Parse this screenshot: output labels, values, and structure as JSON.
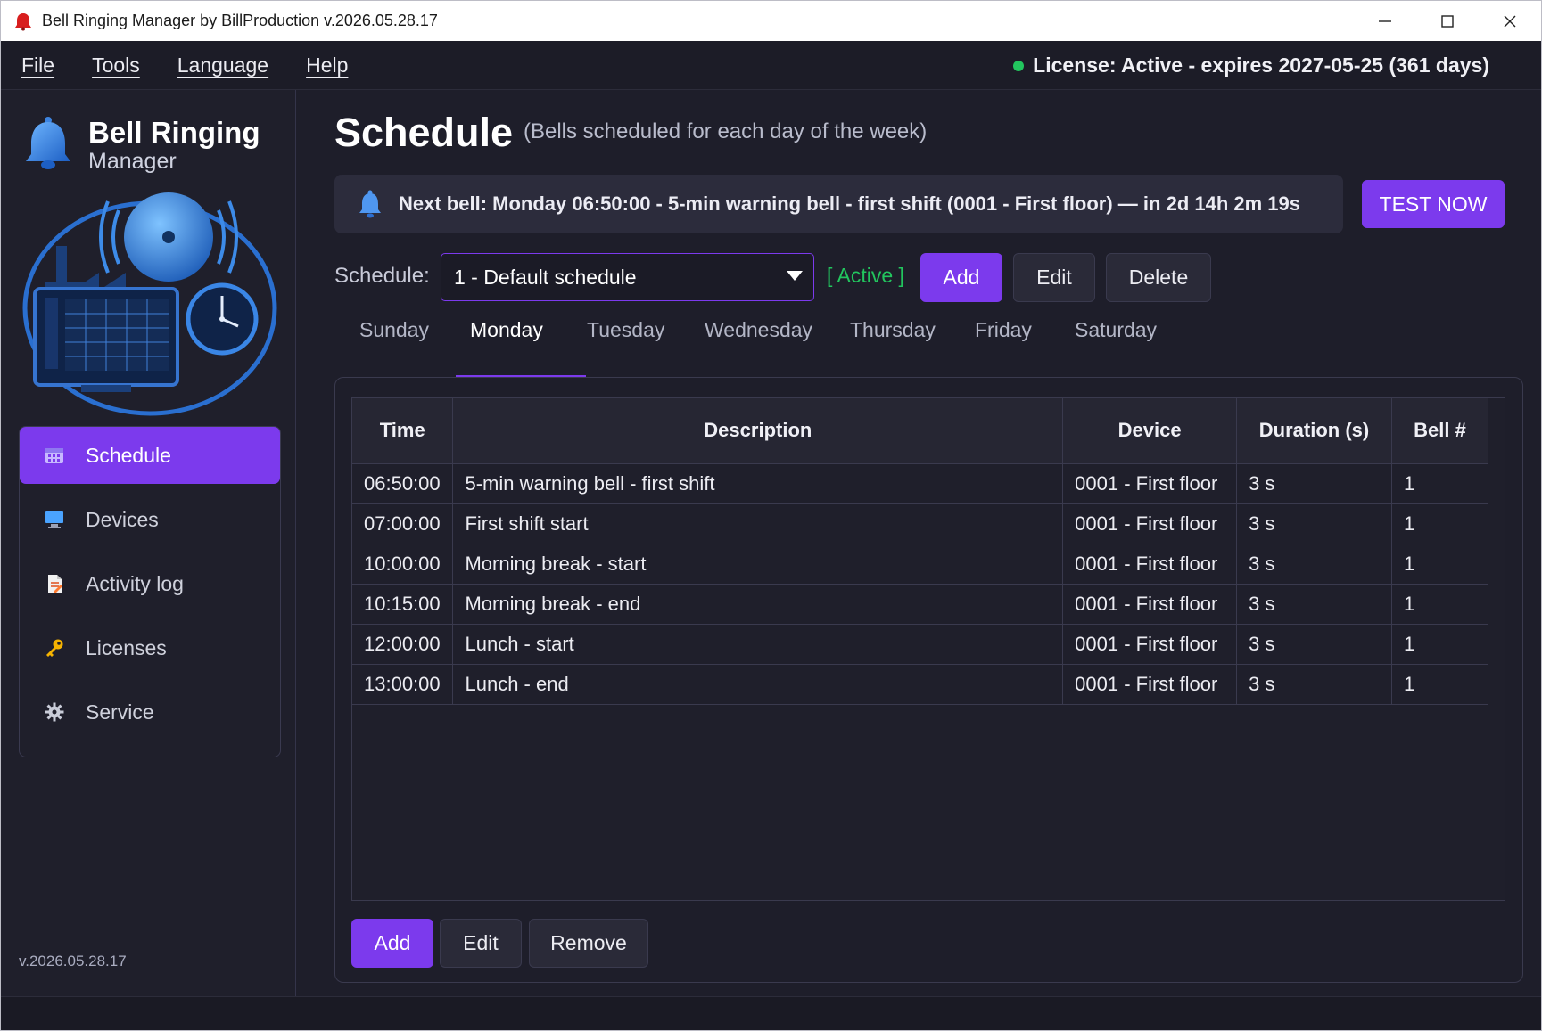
{
  "window": {
    "title": "Bell Ringing Manager by BillProduction  v.2026.05.28.17",
    "minimize_icon": "minimize-icon",
    "maximize_icon": "maximize-icon",
    "close_icon": "close-icon"
  },
  "menu": {
    "items": [
      "File",
      "Tools",
      "Language",
      "Help"
    ],
    "license": "License: Active - expires 2027-05-25 (361 days)",
    "license_color": "#22c55e"
  },
  "sidebar": {
    "brand_name": "Bell Ringing",
    "brand_sub": "Manager",
    "nav": [
      {
        "label": "Schedule",
        "icon": "calendar-icon",
        "active": true
      },
      {
        "label": "Devices",
        "icon": "monitor-icon",
        "active": false
      },
      {
        "label": "Activity log",
        "icon": "document-icon",
        "active": false
      },
      {
        "label": "Licenses",
        "icon": "key-icon",
        "active": false
      },
      {
        "label": "Service",
        "icon": "gear-icon",
        "active": false
      }
    ],
    "version": "v.2026.05.28.17"
  },
  "main": {
    "title": "Schedule",
    "subtitle": "(Bells scheduled for each day of the week)",
    "next_bell": "Next bell: Monday 06:50:00 - 5-min warning bell - first shift (0001 - First floor) — in 2d 14h 2m 19s",
    "test_now": "TEST NOW",
    "schedule_label": "Schedule:",
    "schedule_value": "1 - Default schedule",
    "active_tag": "[ Active ]",
    "schedule_buttons": {
      "add": "Add",
      "edit": "Edit",
      "delete": "Delete"
    },
    "tabs": [
      "Sunday",
      "Monday",
      "Tuesday",
      "Wednesday",
      "Thursday",
      "Friday",
      "Saturday"
    ],
    "active_tab": "Monday",
    "table": {
      "columns": [
        "Time",
        "Description",
        "Device",
        "Duration (s)",
        "Bell #"
      ],
      "rows": [
        [
          "06:50:00",
          "5-min warning bell - first shift",
          "0001 - First floor",
          "3 s",
          "1"
        ],
        [
          "07:00:00",
          "First shift start",
          "0001 - First floor",
          "3 s",
          "1"
        ],
        [
          "10:00:00",
          "Morning break - start",
          "0001 - First floor",
          "3 s",
          "1"
        ],
        [
          "10:15:00",
          "Morning break - end",
          "0001 - First floor",
          "3 s",
          "1"
        ],
        [
          "12:00:00",
          "Lunch - start",
          "0001 - First floor",
          "3 s",
          "1"
        ],
        [
          "13:00:00",
          "Lunch - end",
          "0001 - First floor",
          "3 s",
          "1"
        ]
      ]
    },
    "row_buttons": {
      "add": "Add",
      "edit": "Edit",
      "remove": "Remove"
    },
    "accent_color": "#7c3aed"
  }
}
